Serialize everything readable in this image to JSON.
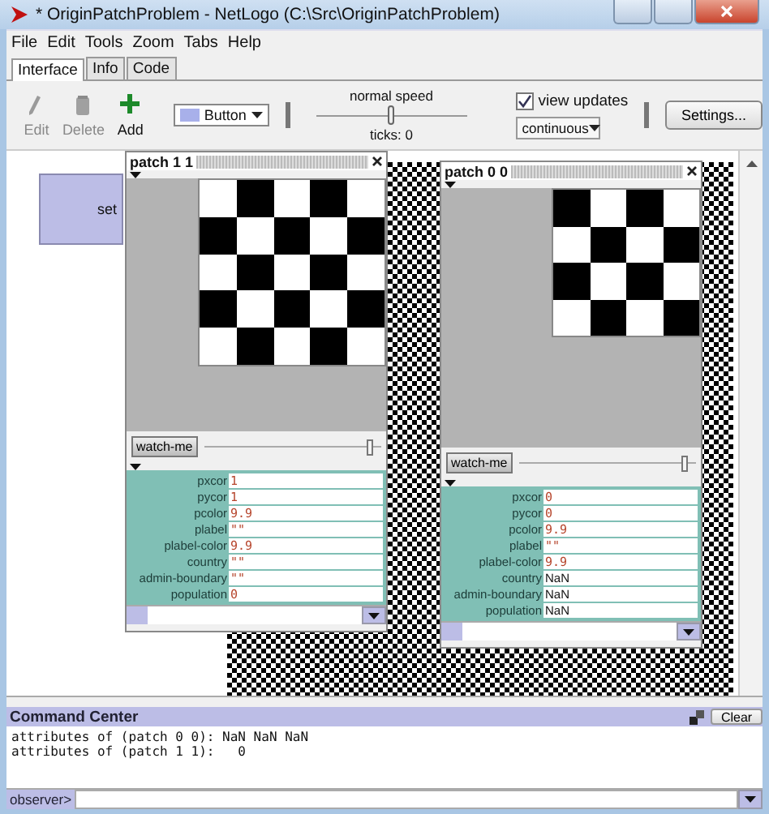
{
  "window": {
    "title": "* OriginPatchProblem - NetLogo (C:\\Src\\OriginPatchProblem)"
  },
  "menu": [
    "File",
    "Edit",
    "Tools",
    "Zoom",
    "Tabs",
    "Help"
  ],
  "tabs": [
    {
      "label": "Interface",
      "selected": true
    },
    {
      "label": "Info",
      "selected": false
    },
    {
      "label": "Code",
      "selected": false
    }
  ],
  "toolbar": {
    "tools": [
      {
        "kind": "edit",
        "label": "Edit",
        "disabled": true
      },
      {
        "kind": "delete",
        "label": "Delete",
        "disabled": true
      },
      {
        "kind": "add",
        "label": "Add",
        "disabled": false
      }
    ],
    "widget_chooser": "Button",
    "speed_label": "normal speed",
    "speed": {
      "level": 0.5
    },
    "ticks": "ticks: 0",
    "view_updates": {
      "label": "view updates",
      "checked": true
    },
    "update_mode": "continuous",
    "settings": "Settings..."
  },
  "interface": {
    "button_widget": "set",
    "inspectors": [
      {
        "title": "patch 1 1",
        "watch_button": "watch-me",
        "zoom": {
          "level": 0.94
        },
        "variables": [
          {
            "name": "pxcor",
            "value": "1",
            "kind": "literal"
          },
          {
            "name": "pycor",
            "value": "1",
            "kind": "literal"
          },
          {
            "name": "pcolor",
            "value": "9.9",
            "kind": "literal"
          },
          {
            "name": "plabel",
            "value": "\"\"",
            "kind": "literal"
          },
          {
            "name": "plabel-color",
            "value": "9.9",
            "kind": "literal"
          },
          {
            "name": "country",
            "value": "\"\"",
            "kind": "literal"
          },
          {
            "name": "admin-boundary",
            "value": "\"\"",
            "kind": "literal"
          },
          {
            "name": "population",
            "value": "0",
            "kind": "literal"
          }
        ]
      },
      {
        "title": "patch 0 0",
        "watch_button": "watch-me",
        "zoom": {
          "level": 0.94
        },
        "variables": [
          {
            "name": "pxcor",
            "value": "0",
            "kind": "literal"
          },
          {
            "name": "pycor",
            "value": "0",
            "kind": "literal"
          },
          {
            "name": "pcolor",
            "value": "9.9",
            "kind": "literal"
          },
          {
            "name": "plabel",
            "value": "\"\"",
            "kind": "literal"
          },
          {
            "name": "plabel-color",
            "value": "9.9",
            "kind": "literal"
          },
          {
            "name": "country",
            "value": "NaN",
            "kind": "plain"
          },
          {
            "name": "admin-boundary",
            "value": "NaN",
            "kind": "plain"
          },
          {
            "name": "population",
            "value": "NaN",
            "kind": "plain"
          }
        ]
      }
    ]
  },
  "command_center": {
    "title": "Command Center",
    "clear": "Clear",
    "output": [
      "attributes of (patch 0 0): NaN NaN NaN",
      "attributes of (patch 1 1):   0"
    ],
    "prompt": "observer>"
  }
}
